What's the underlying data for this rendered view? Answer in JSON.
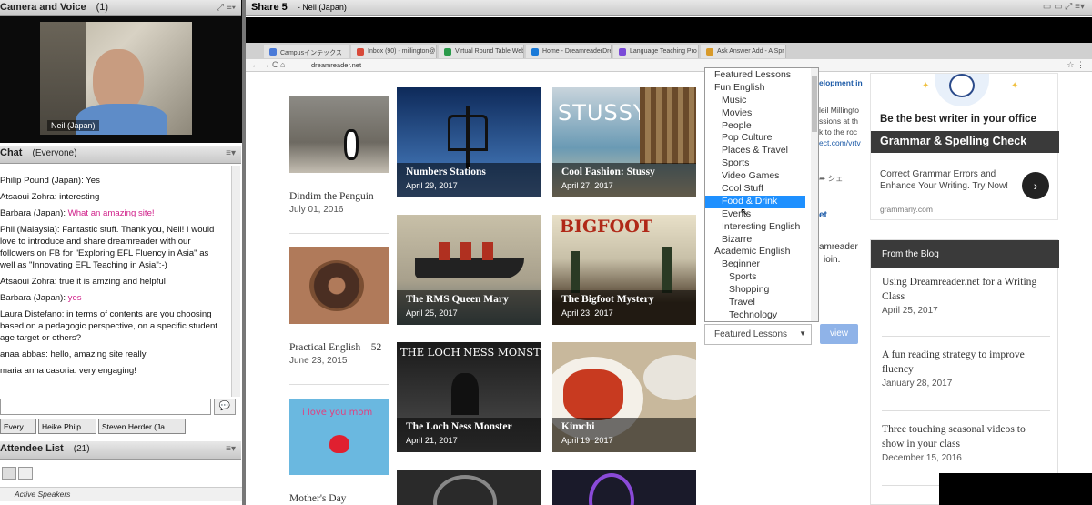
{
  "camera_pod": {
    "title": "Camera and Voice",
    "count": "(1)",
    "video_label": "Neil (Japan)"
  },
  "chat_pod": {
    "title": "Chat",
    "scope": "(Everyone)",
    "messages": [
      {
        "who": "Philip Pound (Japan): ",
        "text": "Yes",
        "pink": false
      },
      {
        "who": "Atsaoui Zohra: ",
        "text": "interesting",
        "pink": false
      },
      {
        "who": "Barbara (Japan): ",
        "text": "What an amazing site!",
        "pink": true
      },
      {
        "who": "Phil (Malaysia): ",
        "text": "Fantastic stuff. Thank you, Neil! I would love to introduce and share dreamreader with our followers on FB for \"Exploring EFL Fluency in Asia\" as well as \"Innovating EFL Teaching in Asia\":-)",
        "pink": false
      },
      {
        "who": "Atsaoui Zohra: ",
        "text": "true it is amzing and helpful",
        "pink": false
      },
      {
        "who": "Barbara (Japan): ",
        "text": "yes",
        "pink": true
      },
      {
        "who": "Laura Distefano: ",
        "text": "in terms of contents are you choosing based on a pedagogic perspective, on a specific student age target or others?",
        "pink": false
      },
      {
        "who": "anaa abbas: ",
        "text": "hello, amazing site really",
        "pink": false
      },
      {
        "who": "maria anna casoria: ",
        "text": "very engaging!",
        "pink": false
      }
    ],
    "tabs": [
      "Every...",
      "Heike  Philp",
      "Steven Herder (Ja..."
    ]
  },
  "attendee_pod": {
    "title": "Attendee List",
    "count": "(21)",
    "active_label": "Active Speakers"
  },
  "share_pod": {
    "title": "Share 5",
    "presenter": "- Neil (Japan)"
  },
  "browser": {
    "tabs": [
      "Campusインテックス",
      "Inbox (90) - millington@",
      "Virtual Round Table Web",
      "Home - DreamreaderDre",
      "Language Teaching Pro",
      "Ask Answer Add - A Spr"
    ],
    "url": "dreamreader.net"
  },
  "left_column": [
    {
      "title": "Dindim the Penguin",
      "date": "July 01, 2016"
    },
    {
      "title": "Practical English – 52",
      "date": "June 23, 2015"
    },
    {
      "title": "Mother's Day",
      "date": ""
    }
  ],
  "grid": [
    {
      "title": "Numbers Stations",
      "date": "April 29, 2017"
    },
    {
      "title": "Cool Fashion: Stussy",
      "date": "April 27, 2017"
    },
    {
      "title": "The RMS Queen Mary",
      "date": "April 25, 2017"
    },
    {
      "title": "The Bigfoot Mystery",
      "date": "April 23, 2017"
    },
    {
      "title": "The Loch Ness Monster",
      "date": "April 21, 2017"
    },
    {
      "title": "Kimchi",
      "date": "April 19, 2017"
    }
  ],
  "thumb_text": {
    "stussy": "STUSSY",
    "bigfoot": "BIGFOOT",
    "loch": "THE LOCH NESS MONSTER",
    "love": "i love you mom"
  },
  "dropdown": {
    "items": [
      {
        "label": "Featured Lessons",
        "level": 0
      },
      {
        "label": "Fun English",
        "level": 0
      },
      {
        "label": "Music",
        "level": 1
      },
      {
        "label": "Movies",
        "level": 1
      },
      {
        "label": "People",
        "level": 1
      },
      {
        "label": "Pop Culture",
        "level": 1
      },
      {
        "label": "Places & Travel",
        "level": 1
      },
      {
        "label": "Sports",
        "level": 1
      },
      {
        "label": "Video Games",
        "level": 1
      },
      {
        "label": "Cool Stuff",
        "level": 1
      },
      {
        "label": "Food & Drink",
        "level": 1,
        "selected": true
      },
      {
        "label": "Events",
        "level": 1
      },
      {
        "label": "Interesting English",
        "level": 1
      },
      {
        "label": "Bizarre",
        "level": 1
      },
      {
        "label": "Academic English",
        "level": 0
      },
      {
        "label": "Beginner",
        "level": 1
      },
      {
        "label": "Sports",
        "level": 2
      },
      {
        "label": "Shopping",
        "level": 2
      },
      {
        "label": "Travel",
        "level": 2
      },
      {
        "label": "Technology",
        "level": 2
      }
    ],
    "selected_value": "Featured Lessons",
    "view_label": "view"
  },
  "behind_text": {
    "l1": "elopment in",
    "l2": "leil Millingto",
    "l3": "ssions at th",
    "l4": "k to the roc",
    "l5": "ect.com/vrtv",
    "share": "シェ",
    "et": "et",
    "l6": "amreader",
    "l7": "ioin."
  },
  "ad": {
    "tagline": "Be the best writer in your office",
    "bar": "Grammar & Spelling Check",
    "body": "Correct Grammar Errors and Enhance Your Writing. Try Now!",
    "domain": "grammarly.com"
  },
  "blog": {
    "header": "From the Blog",
    "posts": [
      {
        "title": "Using Dreamreader.net for a Writing Class",
        "date": "April 25, 2017"
      },
      {
        "title": "A fun reading strategy to improve fluency",
        "date": "January 28, 2017"
      },
      {
        "title": "Three touching seasonal videos to show in your class",
        "date": "December 15, 2016"
      }
    ]
  },
  "colors": {
    "dropdown_selected": "#1e90ff",
    "chat_pink": "#d0208a",
    "view_button": "#8fb3e8"
  }
}
